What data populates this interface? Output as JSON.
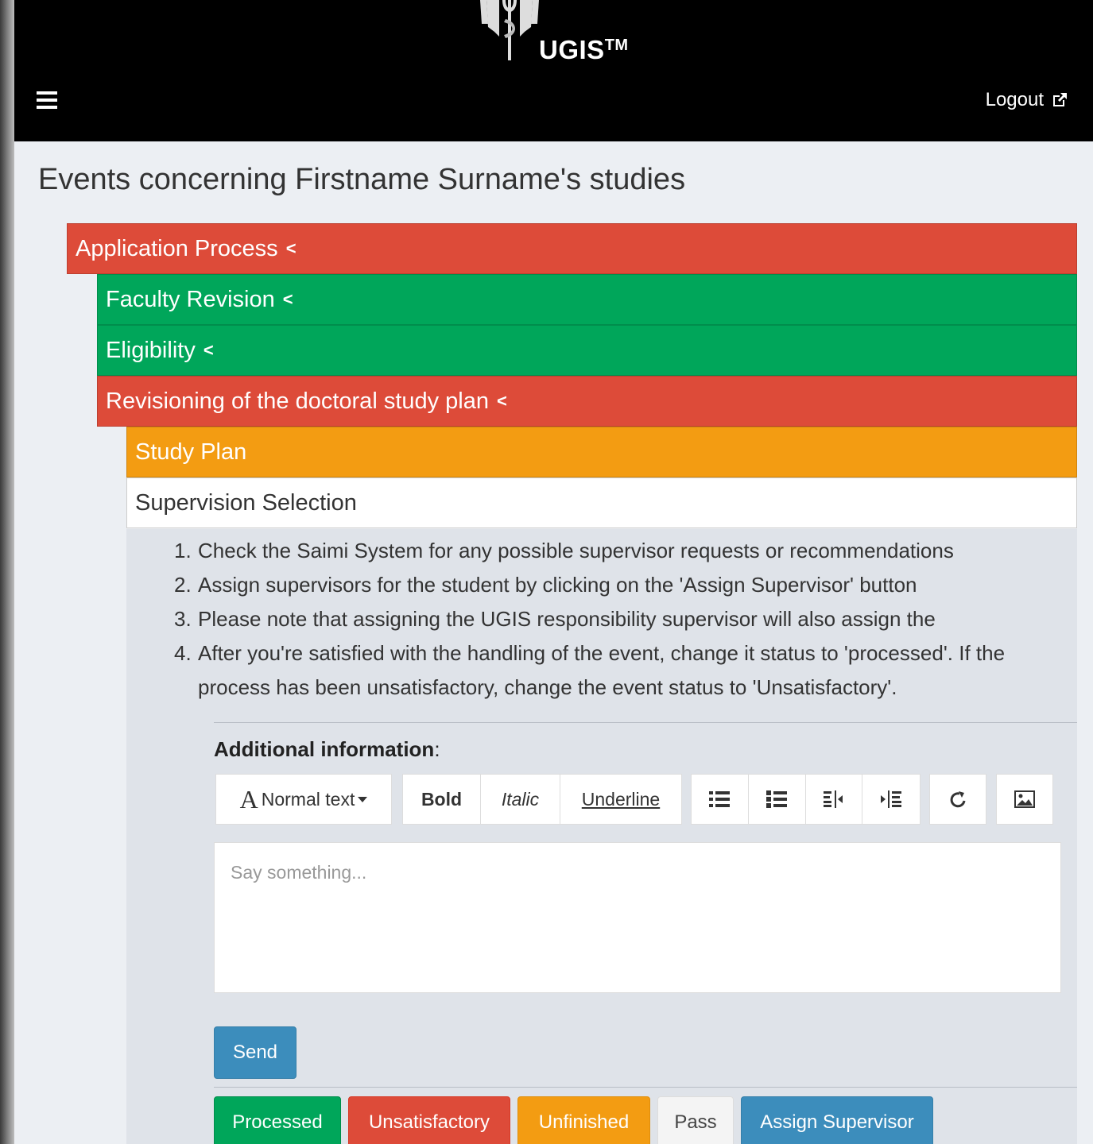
{
  "header": {
    "brand": "UGIS",
    "brand_tm": "TM",
    "logout_label": "Logout"
  },
  "page_title": "Events concerning Firstname Surname's studies",
  "events": [
    {
      "label": "Application Process",
      "status": "red",
      "chevron": "<"
    },
    {
      "label": "Faculty Revision",
      "status": "green",
      "chevron": "<"
    },
    {
      "label": "Eligibility",
      "status": "green",
      "chevron": "<"
    },
    {
      "label": "Revisioning of the doctoral study plan",
      "status": "red",
      "chevron": "<"
    },
    {
      "label": "Study Plan",
      "status": "orange"
    },
    {
      "label": "Supervision Selection",
      "status": "white"
    }
  ],
  "instructions": [
    {
      "num": "1.",
      "text": "Check the Saimi System for any possible supervisor requests or recommendations"
    },
    {
      "num": "2.",
      "text": "Assign supervisors for the student by clicking on the 'Assign Supervisor' button"
    },
    {
      "num": "3.",
      "text": "Please note that assigning the UGIS responsibility supervisor will also assign the"
    },
    {
      "num": "4.",
      "text": "After you're satisfied with the handling of the event, change it status to 'processed'. If the process has been unsatisfactory, change the event status to 'Unsatisfactory'."
    }
  ],
  "additional_info": {
    "label": "Additional information",
    "colon": ":"
  },
  "toolbar": {
    "text_format_glyph": "A",
    "text_format_label": "Normal text",
    "bold": "Bold",
    "italic": "Italic",
    "underline": "Underline",
    "icons": [
      "bullet-list-icon",
      "numbered-list-icon",
      "outdent-icon",
      "indent-icon",
      "link-icon",
      "image-icon"
    ]
  },
  "editor": {
    "placeholder": "Say something...",
    "value": ""
  },
  "buttons": {
    "send": "Send",
    "processed": "Processed",
    "unsatisfactory": "Unsatisfactory",
    "unfinished": "Unfinished",
    "pass": "Pass",
    "assign_supervisor": "Assign Supervisor"
  },
  "colors": {
    "red": "#dd4b39",
    "green": "#00a65a",
    "orange": "#f39c12",
    "blue": "#3c8dbc"
  }
}
